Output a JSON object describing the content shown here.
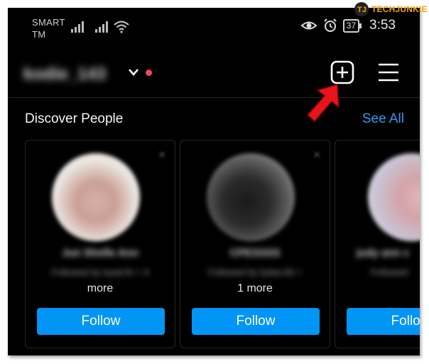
{
  "status_bar": {
    "carrier_line1": "SMART",
    "carrier_line2": "TM",
    "battery": "37",
    "time": "3:53",
    "icons": [
      "signal-icon",
      "signal-icon",
      "wifi-icon",
      "eye-icon",
      "alarm-icon"
    ]
  },
  "watermark": {
    "text": "TECHJUNKIE"
  },
  "header": {
    "username": "kodie_143",
    "icons": [
      "chevron-down-icon",
      "notification-dot",
      "new-post-icon",
      "menu-icon"
    ]
  },
  "discover": {
    "title": "Discover People",
    "see_all": "See All",
    "cards": [
      {
        "name": "Jun Shelle Ann",
        "followed_by": "Followed by kyad.fe + 4",
        "more": "more",
        "follow": "Follow"
      },
      {
        "name": "CPESSSS",
        "followed_by": "Followed by kylaa.tld +",
        "more": "1 more",
        "follow": "Follow"
      },
      {
        "name": "judy ann c",
        "followed_by": "Followed",
        "more": "",
        "follow": "Follow"
      }
    ]
  },
  "colors": {
    "accent": "#0095f6",
    "link": "#3897f0",
    "dot": "#ed4956",
    "annotation_arrow": "#e8141c"
  }
}
